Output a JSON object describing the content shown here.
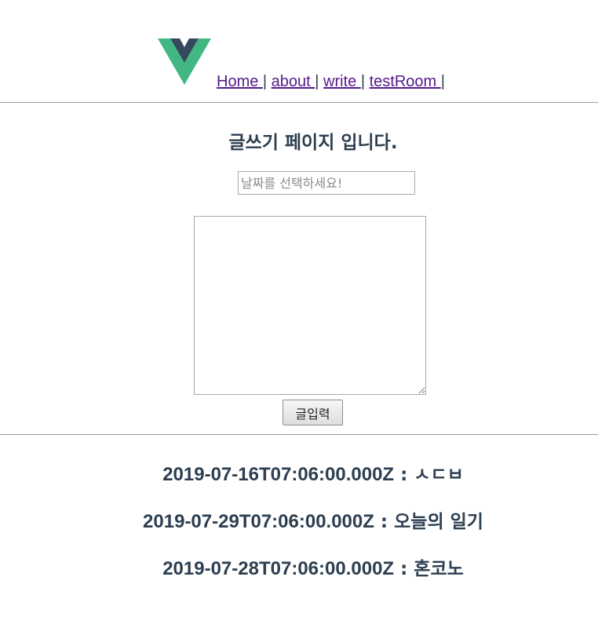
{
  "nav": {
    "links": [
      {
        "label": "Home "
      },
      {
        "label": "about "
      },
      {
        "label": "write "
      },
      {
        "label": "testRoom "
      }
    ],
    "separator": "|"
  },
  "page": {
    "title": "글쓰기 페이지 입니다."
  },
  "form": {
    "date_placeholder": "날짜를 선택하세요!",
    "date_value": "",
    "content_value": "",
    "submit_label": "글입력"
  },
  "entries": [
    {
      "date": "2019-07-16T07:06:00.000Z",
      "sep": " : ",
      "text": "ㅅㄷㅂ"
    },
    {
      "date": "2019-07-29T07:06:00.000Z",
      "sep": " : ",
      "text": "오늘의 일기"
    },
    {
      "date": "2019-07-28T07:06:00.000Z",
      "sep": " : ",
      "text": "혼코노"
    }
  ],
  "colors": {
    "text": "#2c3e50",
    "link_visited": "#551a8b",
    "logo_green": "#41b883",
    "logo_dark": "#35495e"
  }
}
